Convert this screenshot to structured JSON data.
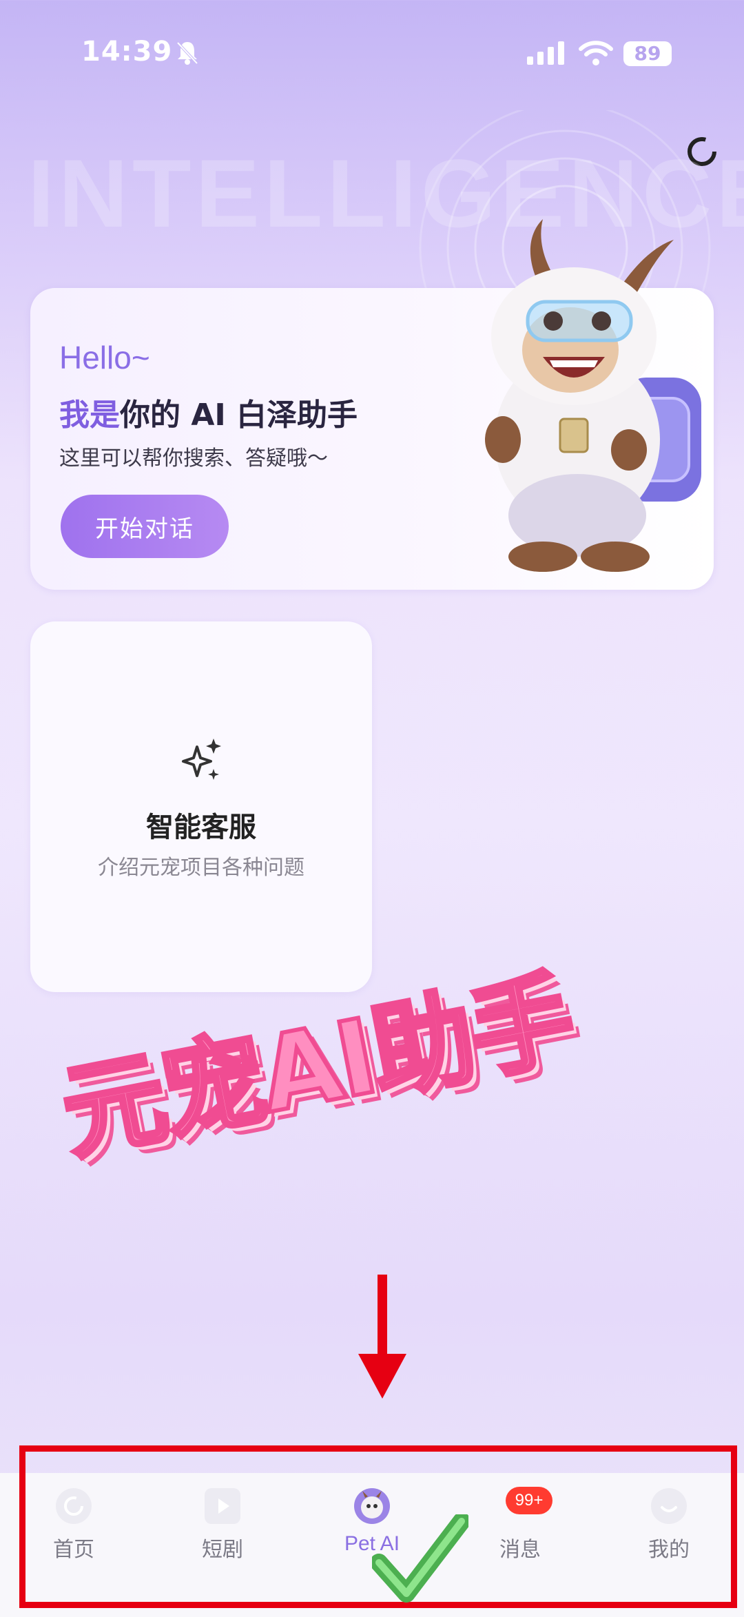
{
  "status_bar": {
    "time": "14:39",
    "battery": "89"
  },
  "hero": {
    "watermark": "INTELLIGENCE",
    "greeting": "Hello~",
    "headline_accent": "我是",
    "headline_rest": "你的 AI 白泽助手",
    "subtitle": "这里可以帮你搜索、答疑哦～",
    "start_button": "开始对话"
  },
  "service_card": {
    "title": "智能客服",
    "subtitle": "介绍元宠项目各种问题"
  },
  "overlay": {
    "sticker_text": "元宠AI助手"
  },
  "tabbar": {
    "items": [
      {
        "label": "首页",
        "icon": "home-icon"
      },
      {
        "label": "短剧",
        "icon": "play-icon"
      },
      {
        "label": "Pet AI",
        "icon": "pet-avatar-icon"
      },
      {
        "label": "消息",
        "icon": "message-icon"
      },
      {
        "label": "我的",
        "icon": "profile-icon"
      }
    ],
    "active_index": 2,
    "message_badge": "99+"
  },
  "colors": {
    "accent": "#8a6ee6",
    "annotation_red": "#e60012",
    "badge_red": "#ff3b30"
  }
}
